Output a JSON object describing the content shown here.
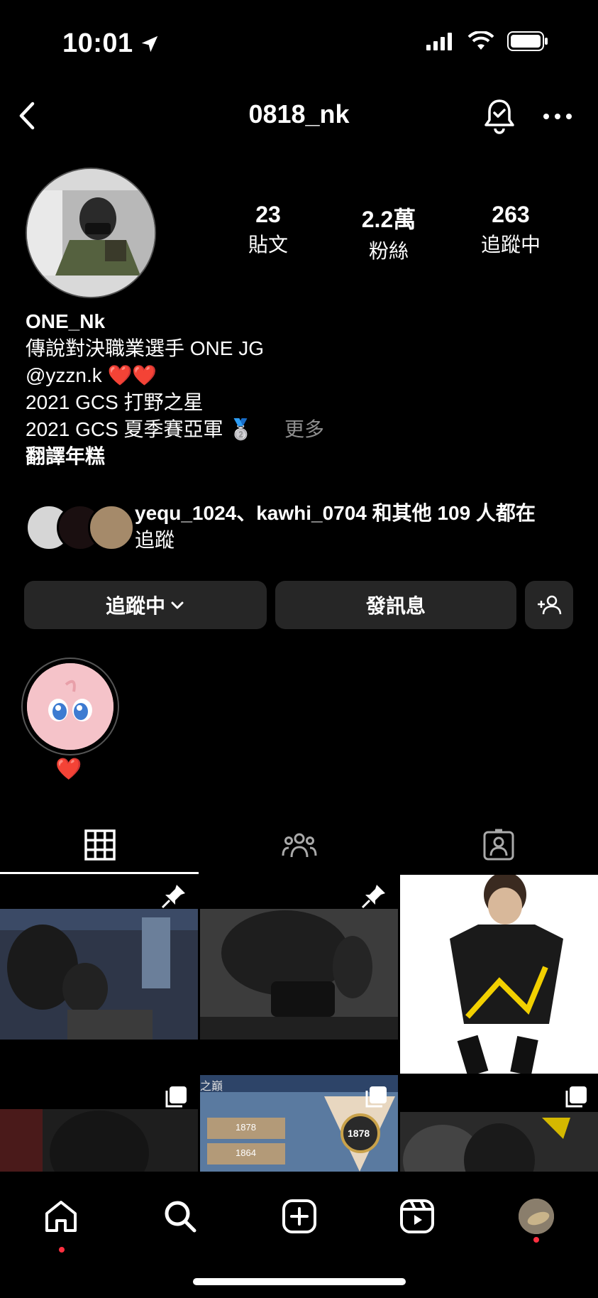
{
  "status": {
    "time": "10:01"
  },
  "header": {
    "username": "0818_nk"
  },
  "stats": [
    {
      "value": "23",
      "label": "貼文"
    },
    {
      "value": "2.2萬",
      "label": "粉絲"
    },
    {
      "value": "263",
      "label": "追蹤中"
    }
  ],
  "bio": {
    "name": "ONE_Nk",
    "line1": "傳說對決職業選手 ONE JG",
    "line2": "@yzzn.k",
    "line2_emoji": "❤️❤️",
    "line3": "2021 GCS 打野之星",
    "line4": "2021 GCS 夏季賽亞軍",
    "line4_emoji": "🥈",
    "more": "更多",
    "translate": "翻譯年糕"
  },
  "followed_by": {
    "text_line1": "yequ_1024、kawhi_0704 和其他 109 人都在",
    "text_line2": "追蹤"
  },
  "buttons": {
    "following": "追蹤中",
    "message": "發訊息"
  },
  "highlights": [
    {
      "label": "❤️"
    }
  ],
  "grid": {
    "row2_labels": {
      "title_fragment": "之巔",
      "score_a": "1878",
      "score_b": "1864",
      "badge": "1878"
    }
  },
  "colors": {
    "accent_red": "#ff3040",
    "button_bg": "#262626",
    "muted": "#8e8e8e"
  }
}
